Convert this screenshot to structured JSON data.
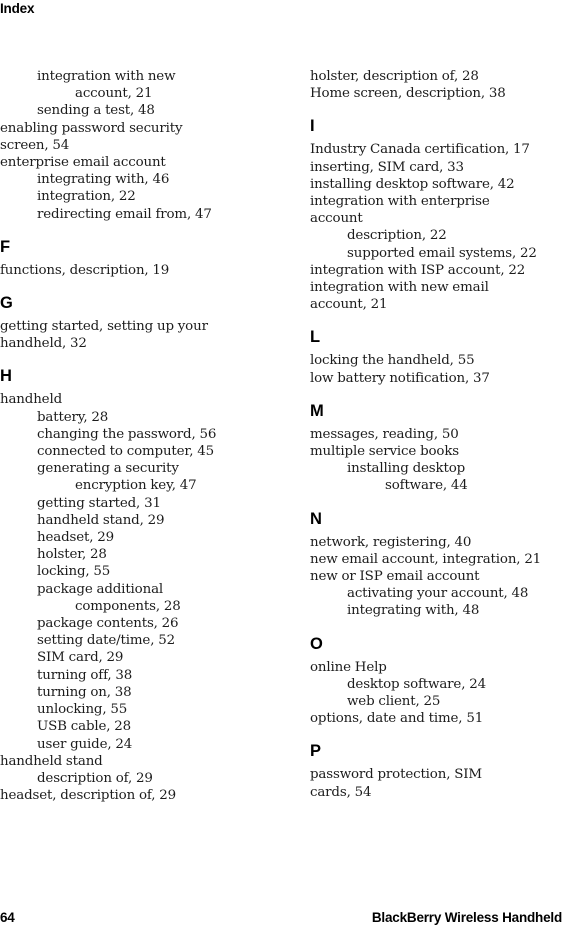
{
  "page": {
    "running_head": "Index",
    "folio": "64",
    "book_title": "BlackBerry Wireless Handheld"
  },
  "columns": [
    {
      "name": "left-column",
      "blocks": [
        {
          "letter": "",
          "entries": [
            {
              "level": 1,
              "text": "integration with new",
              "indent": "lvl2"
            },
            {
              "level": 2,
              "text": "account, 21",
              "indent": "lvl2cont"
            },
            {
              "level": 2,
              "text": "sending a test, 48",
              "indent": "lvl2"
            },
            {
              "level": 1,
              "text": "enabling password security",
              "indent": "lvl1"
            },
            {
              "level": 1,
              "text": "screen, 54",
              "indent": "lvl1"
            },
            {
              "level": 1,
              "text": "enterprise email account",
              "indent": "lvl1"
            },
            {
              "level": 2,
              "text": "integrating with, 46",
              "indent": "lvl2"
            },
            {
              "level": 2,
              "text": "integration, 22",
              "indent": "lvl2"
            },
            {
              "level": 2,
              "text": "redirecting email from, 47",
              "indent": "lvl2"
            }
          ]
        },
        {
          "letter": "F",
          "entries": [
            {
              "level": 1,
              "text": "functions, description, 19",
              "indent": "lvl1"
            }
          ]
        },
        {
          "letter": "G",
          "entries": [
            {
              "level": 1,
              "text": "getting started, setting up your",
              "indent": "lvl1"
            },
            {
              "level": 1,
              "text": "handheld, 32",
              "indent": "lvl1"
            }
          ]
        },
        {
          "letter": "H",
          "entries": [
            {
              "level": 1,
              "text": "handheld",
              "indent": "lvl1"
            },
            {
              "level": 2,
              "text": "battery, 28",
              "indent": "lvl2"
            },
            {
              "level": 2,
              "text": "changing the password, 56",
              "indent": "lvl2"
            },
            {
              "level": 2,
              "text": "connected to computer, 45",
              "indent": "lvl2"
            },
            {
              "level": 2,
              "text": "generating a security",
              "indent": "lvl2"
            },
            {
              "level": 2,
              "text": "encryption key, 47",
              "indent": "lvl2cont"
            },
            {
              "level": 2,
              "text": "getting started, 31",
              "indent": "lvl2"
            },
            {
              "level": 2,
              "text": "handheld stand, 29",
              "indent": "lvl2"
            },
            {
              "level": 2,
              "text": "headset, 29",
              "indent": "lvl2"
            },
            {
              "level": 2,
              "text": "holster, 28",
              "indent": "lvl2"
            },
            {
              "level": 2,
              "text": "locking, 55",
              "indent": "lvl2"
            },
            {
              "level": 2,
              "text": "package additional",
              "indent": "lvl2"
            },
            {
              "level": 2,
              "text": "components, 28",
              "indent": "lvl2cont"
            },
            {
              "level": 2,
              "text": "package contents, 26",
              "indent": "lvl2"
            },
            {
              "level": 2,
              "text": "setting date/time, 52",
              "indent": "lvl2"
            },
            {
              "level": 2,
              "text": "SIM card, 29",
              "indent": "lvl2"
            },
            {
              "level": 2,
              "text": "turning off, 38",
              "indent": "lvl2"
            },
            {
              "level": 2,
              "text": "turning on, 38",
              "indent": "lvl2"
            },
            {
              "level": 2,
              "text": "unlocking, 55",
              "indent": "lvl2"
            },
            {
              "level": 2,
              "text": "USB cable, 28",
              "indent": "lvl2"
            },
            {
              "level": 2,
              "text": "user guide, 24",
              "indent": "lvl2"
            },
            {
              "level": 1,
              "text": "handheld stand",
              "indent": "lvl1"
            },
            {
              "level": 2,
              "text": "description of, 29",
              "indent": "lvl2"
            },
            {
              "level": 1,
              "text": "headset, description of, 29",
              "indent": "lvl1"
            }
          ]
        }
      ]
    },
    {
      "name": "right-column",
      "blocks": [
        {
          "letter": "",
          "entries": [
            {
              "level": 1,
              "text": "holster, description of, 28",
              "indent": "lvl1"
            },
            {
              "level": 1,
              "text": "Home screen, description, 38",
              "indent": "lvl1"
            }
          ]
        },
        {
          "letter": "I",
          "entries": [
            {
              "level": 1,
              "text": "Industry Canada certification, 17",
              "indent": "lvl1"
            },
            {
              "level": 1,
              "text": "inserting, SIM card, 33",
              "indent": "lvl1"
            },
            {
              "level": 1,
              "text": "installing desktop software, 42",
              "indent": "lvl1"
            },
            {
              "level": 1,
              "text": "integration with enterprise",
              "indent": "lvl1"
            },
            {
              "level": 1,
              "text": "account",
              "indent": "lvl1"
            },
            {
              "level": 2,
              "text": "description, 22",
              "indent": "lvl2"
            },
            {
              "level": 2,
              "text": "supported email systems, 22",
              "indent": "lvl2"
            },
            {
              "level": 1,
              "text": "integration with ISP account, 22",
              "indent": "lvl1"
            },
            {
              "level": 1,
              "text": "integration with new email",
              "indent": "lvl1"
            },
            {
              "level": 1,
              "text": "account, 21",
              "indent": "lvl1"
            }
          ]
        },
        {
          "letter": "L",
          "entries": [
            {
              "level": 1,
              "text": "locking the handheld, 55",
              "indent": "lvl1"
            },
            {
              "level": 1,
              "text": "low battery notification, 37",
              "indent": "lvl1"
            }
          ]
        },
        {
          "letter": "M",
          "entries": [
            {
              "level": 1,
              "text": "messages, reading, 50",
              "indent": "lvl1"
            },
            {
              "level": 1,
              "text": "multiple service books",
              "indent": "lvl1"
            },
            {
              "level": 2,
              "text": "installing desktop",
              "indent": "lvl2"
            },
            {
              "level": 2,
              "text": "software, 44",
              "indent": "lvl2cont"
            }
          ]
        },
        {
          "letter": "N",
          "entries": [
            {
              "level": 1,
              "text": "network, registering, 40",
              "indent": "lvl1"
            },
            {
              "level": 1,
              "text": "new email account, integration, 21",
              "indent": "lvl1"
            },
            {
              "level": 1,
              "text": "new or ISP email account",
              "indent": "lvl1"
            },
            {
              "level": 2,
              "text": "activating your account, 48",
              "indent": "lvl2"
            },
            {
              "level": 2,
              "text": "integrating with, 48",
              "indent": "lvl2"
            }
          ]
        },
        {
          "letter": "O",
          "entries": [
            {
              "level": 1,
              "text": "online Help",
              "indent": "lvl1"
            },
            {
              "level": 2,
              "text": "desktop software, 24",
              "indent": "lvl2"
            },
            {
              "level": 2,
              "text": "web client, 25",
              "indent": "lvl2"
            },
            {
              "level": 1,
              "text": "options, date and time, 51",
              "indent": "lvl1"
            }
          ]
        },
        {
          "letter": "P",
          "entries": [
            {
              "level": 1,
              "text": "password protection, SIM",
              "indent": "lvl1"
            },
            {
              "level": 1,
              "text": "cards, 54",
              "indent": "lvl1"
            }
          ]
        }
      ]
    }
  ]
}
